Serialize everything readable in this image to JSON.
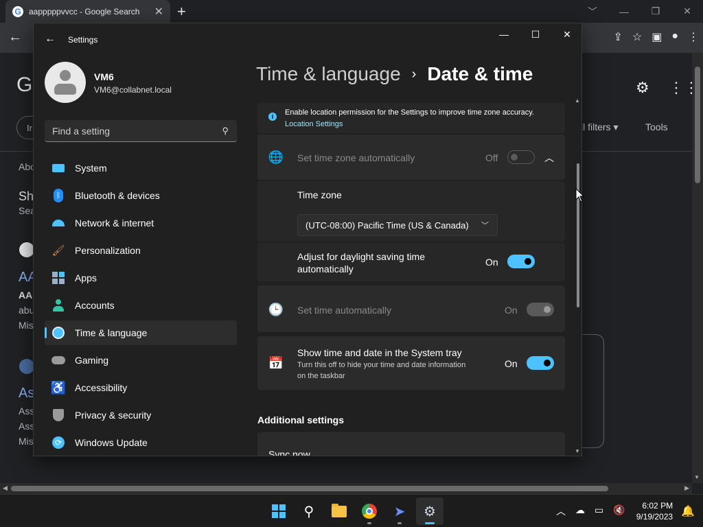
{
  "chrome": {
    "tab_title": "aapppppvvcc - Google Search",
    "new_tab": "+",
    "tab_close": "✕",
    "win_min": "﹀",
    "win_min2": "—",
    "win_max": "❐",
    "win_close": "✕",
    "back": "←",
    "toolbar": [
      "⇪",
      "☆",
      "▣",
      "●",
      "⋮"
    ]
  },
  "google": {
    "logo_letter": "G",
    "filters": "ll filters ▾",
    "tools": "Tools",
    "pill_text": "Ir",
    "fragments": {
      "about": "Abo",
      "sh": "Sh",
      "se": "Sea",
      "aa_link": "AA",
      "aa_bold": "AA",
      "abu": "abu",
      "mis1": "Mis",
      "as_link": "As",
      "ass1": "Ass",
      "ass2": "Ass",
      "mis2": "Mis"
    }
  },
  "settings": {
    "title": "Settings",
    "back": "←",
    "win_min": "—",
    "win_max": "☐",
    "win_close": "✕",
    "user": {
      "name": "VM6",
      "email": "VM6@collabnet.local"
    },
    "search_placeholder": "Find a setting",
    "nav": [
      {
        "label": "System",
        "icon": "system-icon",
        "color": "#4cc2ff"
      },
      {
        "label": "Bluetooth & devices",
        "icon": "bluetooth-icon",
        "color": "#1f8fff"
      },
      {
        "label": "Network & internet",
        "icon": "wifi-icon",
        "color": "#4cc2ff"
      },
      {
        "label": "Personalization",
        "icon": "brush-icon",
        "color": "#e08a4a"
      },
      {
        "label": "Apps",
        "icon": "apps-icon",
        "color": "#9ab0c8"
      },
      {
        "label": "Accounts",
        "icon": "accounts-icon",
        "color": "#2fc7a6"
      },
      {
        "label": "Time & language",
        "icon": "globe-clock-icon",
        "color": "#4cc2ff",
        "active": true
      },
      {
        "label": "Gaming",
        "icon": "gamepad-icon",
        "color": "#9a9a9a"
      },
      {
        "label": "Accessibility",
        "icon": "accessibility-icon",
        "color": "#4cc2ff"
      },
      {
        "label": "Privacy & security",
        "icon": "shield-icon",
        "color": "#9a9a9a"
      },
      {
        "label": "Windows Update",
        "icon": "update-icon",
        "color": "#4cc2ff"
      }
    ],
    "breadcrumb": {
      "parent": "Time & language",
      "separator": "›",
      "current": "Date & time"
    },
    "info_banner": {
      "text": "Enable location permission for the Settings to improve time zone accuracy.",
      "link": "Location Settings"
    },
    "tz_auto": {
      "label": "Set time zone automatically",
      "state": "Off"
    },
    "time_zone": {
      "label": "Time zone",
      "value": "(UTC-08:00) Pacific Time (US & Canada)"
    },
    "dst": {
      "line1": "Adjust for daylight saving time",
      "line2": "automatically",
      "state": "On"
    },
    "time_auto": {
      "label": "Set time automatically",
      "state": "On"
    },
    "tray_show": {
      "title": "Show time and date in the System tray",
      "sub1": "Turn this off to hide your time and date information",
      "sub2": "on the taskbar",
      "state": "On"
    },
    "additional_title": "Additional settings",
    "sync_now": "Sync now"
  },
  "taskbar": {
    "time": "6:02 PM",
    "date": "9/19/2023",
    "tray": [
      "︿",
      "☁",
      "▭",
      "🔇"
    ],
    "bell": "🔔"
  },
  "colors": {
    "accent": "#4cc2ff"
  }
}
